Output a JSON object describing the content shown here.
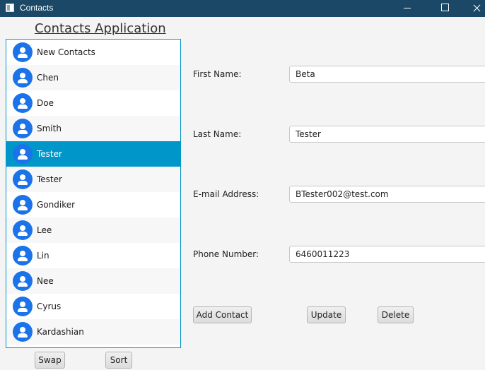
{
  "window": {
    "title": "Contacts"
  },
  "app": {
    "title": "Contacts Application"
  },
  "contacts": [
    {
      "name": "New Contacts"
    },
    {
      "name": "Chen"
    },
    {
      "name": "Doe"
    },
    {
      "name": "Smith"
    },
    {
      "name": "Tester",
      "selected": true
    },
    {
      "name": "Tester"
    },
    {
      "name": "Gondiker"
    },
    {
      "name": "Lee"
    },
    {
      "name": "Lin"
    },
    {
      "name": "Nee"
    },
    {
      "name": "Cyrus"
    },
    {
      "name": "Kardashian"
    }
  ],
  "list_buttons": {
    "swap": "Swap",
    "sort": "Sort"
  },
  "form": {
    "first_name": {
      "label": "First Name:",
      "value": "Beta"
    },
    "last_name": {
      "label": "Last Name:",
      "value": "Tester"
    },
    "email": {
      "label": "E-mail Address:",
      "value": "BTester002@test.com"
    },
    "phone": {
      "label": "Phone Number:",
      "value": "6460011223"
    }
  },
  "actions": {
    "add": "Add Contact",
    "update": "Update",
    "delete": "Delete"
  },
  "colors": {
    "titlebar": "#1a4866",
    "selection": "#0096c9",
    "avatar": "#1a73e8"
  }
}
